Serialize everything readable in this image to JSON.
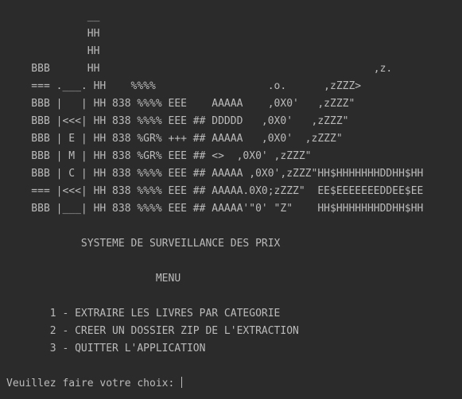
{
  "console": {
    "logo_lines": [
      "             __",
      "             HH",
      "             HH",
      "    BBB      HH                                            ,z.",
      "    === .___. HH    %%%%                  .o.      ,zZZZ>",
      "    BBB |   | HH 838 %%%% EEE    AAAAA    ,0X0'   ,zZZZ\"",
      "    BBB |<<<| HH 838 %%%% EEE ## DDDDD   ,0X0'   ,zZZZ\"",
      "    BBB | E | HH 838 %GR% +++ ## AAAAA   ,0X0'  ,zZZZ\"",
      "    BBB | M | HH 838 %GR% EEE ## <>  ,0X0' ,zZZZ\"",
      "    BBB | C | HH 838 %%%% EEE ## AAAAA ,0X0',zZZZ\"HH$HHHHHHHDDHH$HH",
      "    === |<<<| HH 838 %%%% EEE ## AAAAA.0X0;zZZZ\"  EE$EEEEEEEDDEE$EE",
      "    BBB |___| HH 838 %%%% EEE ## AAAAA'\"0' \"Z\"    HH$HHHHHHHDDHH$HH"
    ],
    "title": "            SYSTEME DE SURVEILLANCE DES PRIX",
    "menu_heading": "                        MENU",
    "menu_items": [
      "       1 - EXTRAIRE LES LIVRES PAR CATEGORIE",
      "       2 - CREER UN DOSSIER ZIP DE L'EXTRACTION",
      "       3 - QUITTER L'APPLICATION"
    ],
    "prompt": "Veuillez faire votre choix:"
  },
  "colors": {
    "background": "#2b2b2b",
    "text": "#bbbbbb"
  }
}
